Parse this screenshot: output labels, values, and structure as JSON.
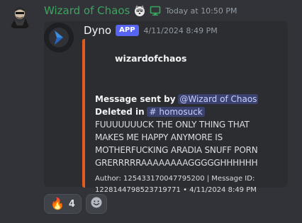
{
  "message": {
    "author": "Wizard of Chaos",
    "timestamp": "Today at 10:50 PM",
    "badges": [
      "husky-icon",
      "monitor-icon"
    ]
  },
  "bot": {
    "name": "Dyno",
    "tag": "APP",
    "timestamp": "4/11/2024 8:49 PM",
    "accent": "#e35a23"
  },
  "embed": {
    "author": "wizardofchaos",
    "sent_by_label": "Message sent by",
    "sent_by_mention": "@Wizard of Chaos",
    "deleted_in_label": "Deleted in",
    "channel_hash": "#",
    "channel_name": "homosuck",
    "content": "FUUUUUUUCK THE ONLY THING THAT MAKES ME HAPPY ANYMORE IS MOTHERFUCKING ARADIA SNUFF PORN GRERRRRRAAAAAAAAGGGGGHHHHHH",
    "footer_line1": "Author: 125433170047795200 | Message ID:",
    "footer_line2": "1228144798523719771 • 4/11/2024 8:49 PM"
  },
  "reactions": [
    {
      "emoji": "🔥",
      "count": "4"
    }
  ]
}
